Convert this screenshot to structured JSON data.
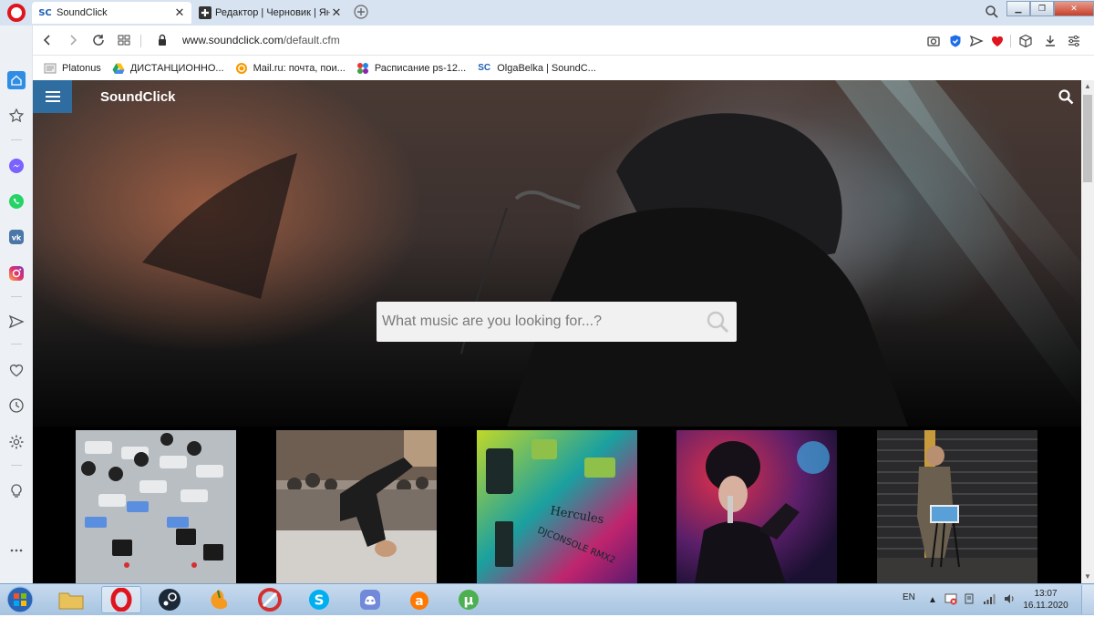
{
  "tabs": [
    {
      "favicon": "SC",
      "title": "SoundClick",
      "close": "✕"
    },
    {
      "favicon": "✚",
      "title": "Редактор | Черновик | Янд",
      "close": "✕"
    }
  ],
  "address": {
    "host": "www.soundclick.com",
    "path": "/default.cfm"
  },
  "bookmarks": [
    {
      "icon": "page-icon",
      "label": "Platonus"
    },
    {
      "icon": "google-drive-icon",
      "label": "ДИСТАНЦИОННО..."
    },
    {
      "icon": "mailru-icon",
      "label": "Mail.ru: почта, пои..."
    },
    {
      "icon": "schedule-icon",
      "label": "Расписание ps-12..."
    },
    {
      "icon": "soundclick-icon",
      "favicon": "SC",
      "label": "OlgaBelka | SoundC..."
    }
  ],
  "site": {
    "brand": "SoundClick",
    "search_placeholder": "What music are you looking for...?"
  },
  "thumbnails": [
    {
      "name": "mixing-console"
    },
    {
      "name": "breakdancer"
    },
    {
      "name": "dj-console"
    },
    {
      "name": "singer"
    },
    {
      "name": "street-performer"
    }
  ],
  "thumbnail_text": {
    "brand": "Hercules",
    "model": "DJCONSOLE RMX2"
  },
  "tray": {
    "language": "EN",
    "time": "13:07",
    "date": "16.11.2020"
  },
  "colors": {
    "accent": "#2f6da0",
    "opera_red": "#e0141d",
    "tabbar": "#d7e3f1",
    "sidebar": "#edf1f6"
  }
}
